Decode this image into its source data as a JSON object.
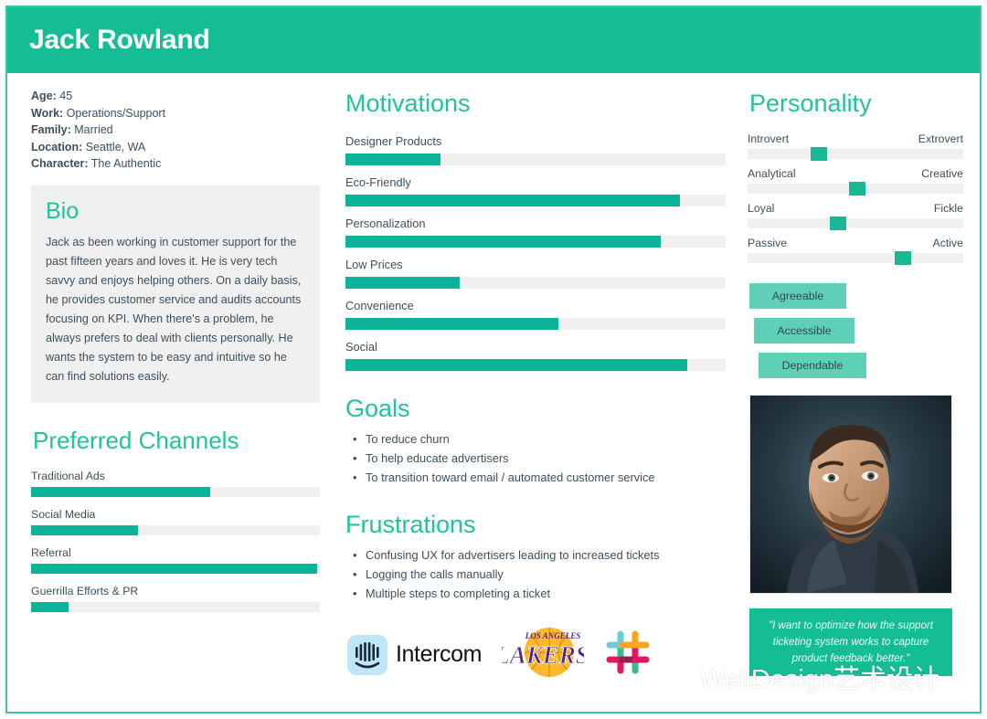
{
  "header": {
    "name": "Jack Rowland"
  },
  "info": [
    {
      "label": "Age:",
      "value": "45"
    },
    {
      "label": "Work:",
      "value": "Operations/Support"
    },
    {
      "label": "Family:",
      "value": " Married"
    },
    {
      "label": "Location:",
      "value": "Seattle, WA"
    },
    {
      "label": "Character:",
      "value": "The Authentic"
    }
  ],
  "bio": {
    "title": "Bio",
    "text": "Jack as been working in customer support for the past fifteen years and loves it. He is very tech savvy and enjoys helping others. On a daily basis, he provides customer service and audits accounts focusing on KPI. When there's a problem, he always prefers to deal with clients personally. He wants the system to be easy and intuitive so he can find solutions easily."
  },
  "channels": {
    "title": "Preferred Channels",
    "items": [
      {
        "label": "Traditional Ads",
        "value": 62
      },
      {
        "label": "Social Media",
        "value": 37
      },
      {
        "label": "Referral",
        "value": 99
      },
      {
        "label": "Guerrilla Efforts & PR",
        "value": 13
      }
    ]
  },
  "motivations": {
    "title": "Motivations",
    "items": [
      {
        "label": "Designer Products",
        "value": 25
      },
      {
        "label": "Eco-Friendly",
        "value": 88
      },
      {
        "label": "Personalization",
        "value": 83
      },
      {
        "label": "Low Prices",
        "value": 30
      },
      {
        "label": "Convenience",
        "value": 56
      },
      {
        "label": "Social",
        "value": 90
      }
    ]
  },
  "goals": {
    "title": "Goals",
    "items": [
      "To reduce churn",
      "To help educate advertisers",
      "To transition toward email / automated customer service"
    ]
  },
  "frustrations": {
    "title": "Frustrations",
    "items": [
      "Confusing UX for advertisers leading to increased tickets",
      "Logging the calls manually",
      "Multiple steps to completing a ticket"
    ]
  },
  "personality": {
    "title": "Personality",
    "sliders": [
      {
        "left": "Introvert",
        "right": "Extrovert",
        "value": 33
      },
      {
        "left": "Analytical",
        "right": "Creative",
        "value": 51
      },
      {
        "left": "Loyal",
        "right": "Fickle",
        "value": 42
      },
      {
        "left": "Passive",
        "right": "Active",
        "value": 72
      }
    ],
    "tags": [
      "Agreeable",
      "Accessible",
      "Dependable"
    ]
  },
  "quote": "\"I want to optimize how the support ticketing system works to capture product feedback better.\"",
  "brands": [
    {
      "name": "intercom-logo",
      "label": "Intercom"
    },
    {
      "name": "lakers-logo",
      "label": "LOS ANGELES LAKERS"
    },
    {
      "name": "slack-logo",
      "label": "Slack"
    }
  ],
  "watermark": {
    "text": "WellDesign艺术设计"
  },
  "colors": {
    "brand_teal": "#15bd95",
    "bar_fill": "#0bb498",
    "track": "#f0f0f0",
    "tag": "#5fd0b7",
    "text": "#3d4f5c"
  },
  "chart_data": [
    {
      "type": "bar",
      "title": "Motivations",
      "categories": [
        "Designer Products",
        "Eco-Friendly",
        "Personalization",
        "Low Prices",
        "Convenience",
        "Social"
      ],
      "values": [
        25,
        88,
        83,
        30,
        56,
        90
      ],
      "xlabel": "",
      "ylabel": "",
      "ylim": [
        0,
        100
      ],
      "orientation": "horizontal"
    },
    {
      "type": "bar",
      "title": "Preferred Channels",
      "categories": [
        "Traditional Ads",
        "Social Media",
        "Referral",
        "Guerrilla Efforts & PR"
      ],
      "values": [
        62,
        37,
        99,
        13
      ],
      "xlabel": "",
      "ylabel": "",
      "ylim": [
        0,
        100
      ],
      "orientation": "horizontal"
    },
    {
      "type": "bar",
      "title": "Personality",
      "categories": [
        "Introvert–Extrovert",
        "Analytical–Creative",
        "Loyal–Fickle",
        "Passive–Active"
      ],
      "values": [
        33,
        51,
        42,
        72
      ],
      "xlabel": "",
      "ylabel": "",
      "ylim": [
        0,
        100
      ],
      "orientation": "horizontal"
    }
  ]
}
